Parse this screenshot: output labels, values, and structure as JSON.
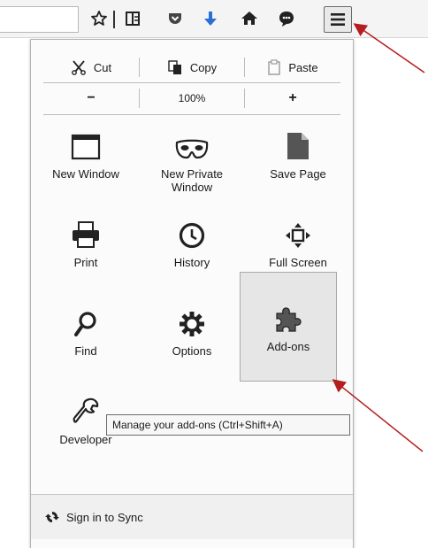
{
  "edit": {
    "cut": "Cut",
    "copy": "Copy",
    "paste": "Paste"
  },
  "zoom": {
    "out": "−",
    "level": "100%",
    "in": "+"
  },
  "items": [
    {
      "label": "New Window",
      "icon": "window-icon"
    },
    {
      "label": "New Private Window",
      "icon": "mask-icon"
    },
    {
      "label": "Save Page",
      "icon": "page-icon"
    },
    {
      "label": "Print",
      "icon": "printer-icon"
    },
    {
      "label": "History",
      "icon": "clock-icon"
    },
    {
      "label": "Full Screen",
      "icon": "fullscreen-icon"
    },
    {
      "label": "Find",
      "icon": "magnifier-icon"
    },
    {
      "label": "Options",
      "icon": "gear-icon"
    },
    {
      "label": "Add-ons",
      "icon": "puzzle-icon"
    },
    {
      "label": "Developer",
      "icon": "wrench-icon"
    }
  ],
  "tooltip": "Manage your add-ons (Ctrl+Shift+A)",
  "footer": {
    "sync": "Sign in to Sync"
  },
  "colors": {
    "pocket": "#444444",
    "download": "#2a6fd6",
    "annotation_arrow": "#b41e1e"
  }
}
